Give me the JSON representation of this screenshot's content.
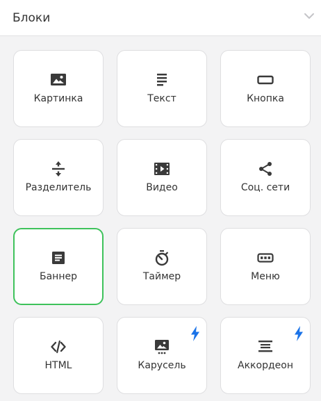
{
  "header": {
    "title": "Блоки",
    "chevron_icon": "chevron-down-icon"
  },
  "blocks": [
    {
      "label": "Картинка",
      "icon": "image-icon",
      "selected": false,
      "premium": false
    },
    {
      "label": "Текст",
      "icon": "text-icon",
      "selected": false,
      "premium": false
    },
    {
      "label": "Кнопка",
      "icon": "button-icon",
      "selected": false,
      "premium": false
    },
    {
      "label": "Разделитель",
      "icon": "divider-icon",
      "selected": false,
      "premium": false
    },
    {
      "label": "Видео",
      "icon": "video-icon",
      "selected": false,
      "premium": false
    },
    {
      "label": "Соц. сети",
      "icon": "share-icon",
      "selected": false,
      "premium": false
    },
    {
      "label": "Баннер",
      "icon": "banner-icon",
      "selected": true,
      "premium": false
    },
    {
      "label": "Таймер",
      "icon": "timer-icon",
      "selected": false,
      "premium": false
    },
    {
      "label": "Меню",
      "icon": "menu-icon",
      "selected": false,
      "premium": false
    },
    {
      "label": "HTML",
      "icon": "code-icon",
      "selected": false,
      "premium": false
    },
    {
      "label": "Карусель",
      "icon": "carousel-icon",
      "selected": false,
      "premium": true
    },
    {
      "label": "Аккордеон",
      "icon": "accordion-icon",
      "selected": false,
      "premium": true
    }
  ],
  "colors": {
    "icon": "#3a3a3a",
    "selected_border": "#3ec25b",
    "premium_bolt": "#1a73e8"
  }
}
